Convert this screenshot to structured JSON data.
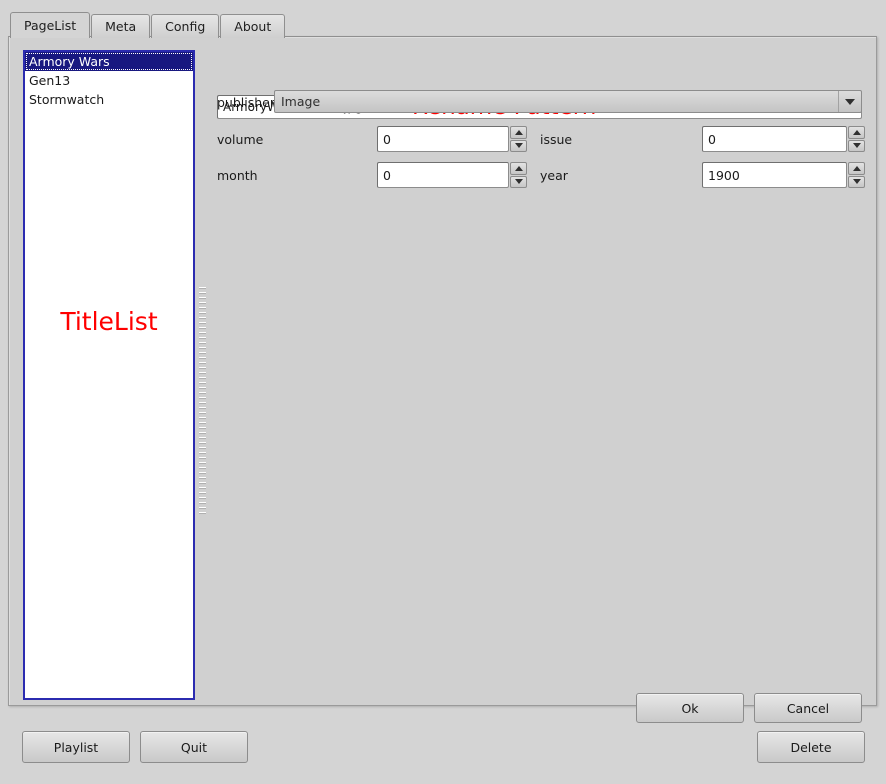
{
  "tabs": [
    {
      "label": "PageList",
      "active": true
    },
    {
      "label": "Meta",
      "active": false
    },
    {
      "label": "Config",
      "active": false
    },
    {
      "label": "About",
      "active": false
    }
  ],
  "title_list": {
    "overlay_label": "TitleList",
    "items": [
      {
        "label": "Armory Wars",
        "selected": true
      },
      {
        "label": "Gen13",
        "selected": false
      },
      {
        "label": "Stormwatch",
        "selected": false
      }
    ]
  },
  "form": {
    "rename_pattern": {
      "value": "ArmoryWars.$(001).jpg",
      "overlay_label": "Rename Pattern"
    },
    "publisher": {
      "label": "publisher",
      "value": "Image"
    },
    "volume": {
      "label": "volume",
      "value": "0"
    },
    "issue": {
      "label": "issue",
      "value": "0"
    },
    "month": {
      "label": "month",
      "value": "0"
    },
    "year": {
      "label": "year",
      "value": "1900"
    }
  },
  "dialog_buttons": {
    "ok": "Ok",
    "cancel": "Cancel"
  },
  "bottom_buttons": {
    "playlist": "Playlist",
    "quit": "Quit",
    "delete": "Delete"
  },
  "colors": {
    "window_background": "#d4d4d4",
    "panel_background": "#d0d0d0",
    "list_selection": "#181880",
    "list_background": "#ffffff",
    "list_border": "#2b2bb0",
    "overlay_text": "#ff0000"
  }
}
